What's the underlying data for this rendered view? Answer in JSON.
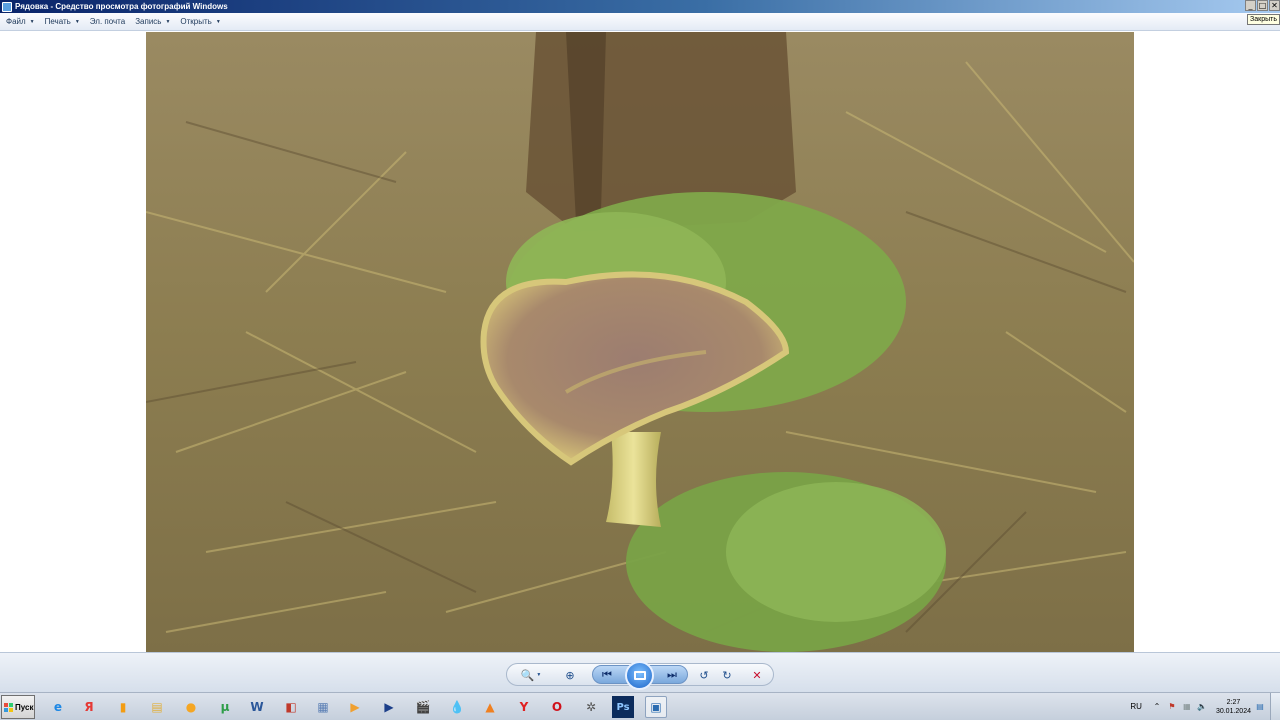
{
  "window": {
    "title": "Рядовка - Средство просмотра фотографий Windows",
    "minimize_glyph": "_",
    "maximize_glyph": "□",
    "close_glyph": "✕",
    "close_tooltip": "Закрыть"
  },
  "menu": {
    "file": "Файл",
    "print": "Печать",
    "email": "Эл. почта",
    "burn": "Запись",
    "open": "Открыть",
    "arrow": "▼"
  },
  "photo": {
    "subject": "mushroom-photo",
    "colors": {
      "ground": "#8a7f55",
      "moss": "#7fa84a",
      "cap": "#a7866a",
      "cap_rim": "#d9c679",
      "stem": "#dcd27d"
    }
  },
  "controls": {
    "zoom_icon": "🔍",
    "zoom_arrow": "▼",
    "fit_icon": "⊕",
    "prev_icon": "⏮",
    "next_icon": "⏭",
    "rotate_ccw_icon": "↺",
    "rotate_cw_icon": "↻",
    "delete_icon": "✕"
  },
  "taskbar": {
    "start_label": "Пуск",
    "apps": [
      {
        "name": "internet-explorer-icon",
        "glyph": "e",
        "color": "#1e88e5"
      },
      {
        "name": "yandex-icon",
        "glyph": "Я",
        "color": "#e53935"
      },
      {
        "name": "files-icon",
        "glyph": "▮",
        "color": "#f39c12"
      },
      {
        "name": "explorer-icon",
        "glyph": "▤",
        "color": "#e0b040"
      },
      {
        "name": "media-icon",
        "glyph": "●",
        "color": "#f5a623"
      },
      {
        "name": "torrent-icon",
        "glyph": "μ",
        "color": "#2e9d48"
      },
      {
        "name": "word-icon",
        "glyph": "W",
        "color": "#2b579a"
      },
      {
        "name": "archive-icon",
        "glyph": "◧",
        "color": "#c0392b"
      },
      {
        "name": "document-icon",
        "glyph": "▦",
        "color": "#5b7fb5"
      },
      {
        "name": "video-player-icon",
        "glyph": "▶",
        "color": "#f0a030"
      },
      {
        "name": "play-icon",
        "glyph": "▶",
        "color": "#1c3f8a"
      },
      {
        "name": "film-icon",
        "glyph": "🎬",
        "color": "#444444"
      },
      {
        "name": "drop-icon",
        "glyph": "💧",
        "color": "#3b82c4"
      },
      {
        "name": "aimp-icon",
        "glyph": "▲",
        "color": "#f08020"
      },
      {
        "name": "yandex-browser-icon",
        "glyph": "Y",
        "color": "#e02020"
      },
      {
        "name": "opera-icon",
        "glyph": "O",
        "color": "#d0101a"
      },
      {
        "name": "reel-icon",
        "glyph": "✲",
        "color": "#555555"
      },
      {
        "name": "photoshop-icon",
        "glyph": "Ps",
        "color": "#0c2c5c"
      },
      {
        "name": "photo-viewer-icon",
        "glyph": "▣",
        "color": "#2b6cb0"
      }
    ],
    "language": "RU",
    "time": "2:27",
    "date": "30.01.2024"
  }
}
